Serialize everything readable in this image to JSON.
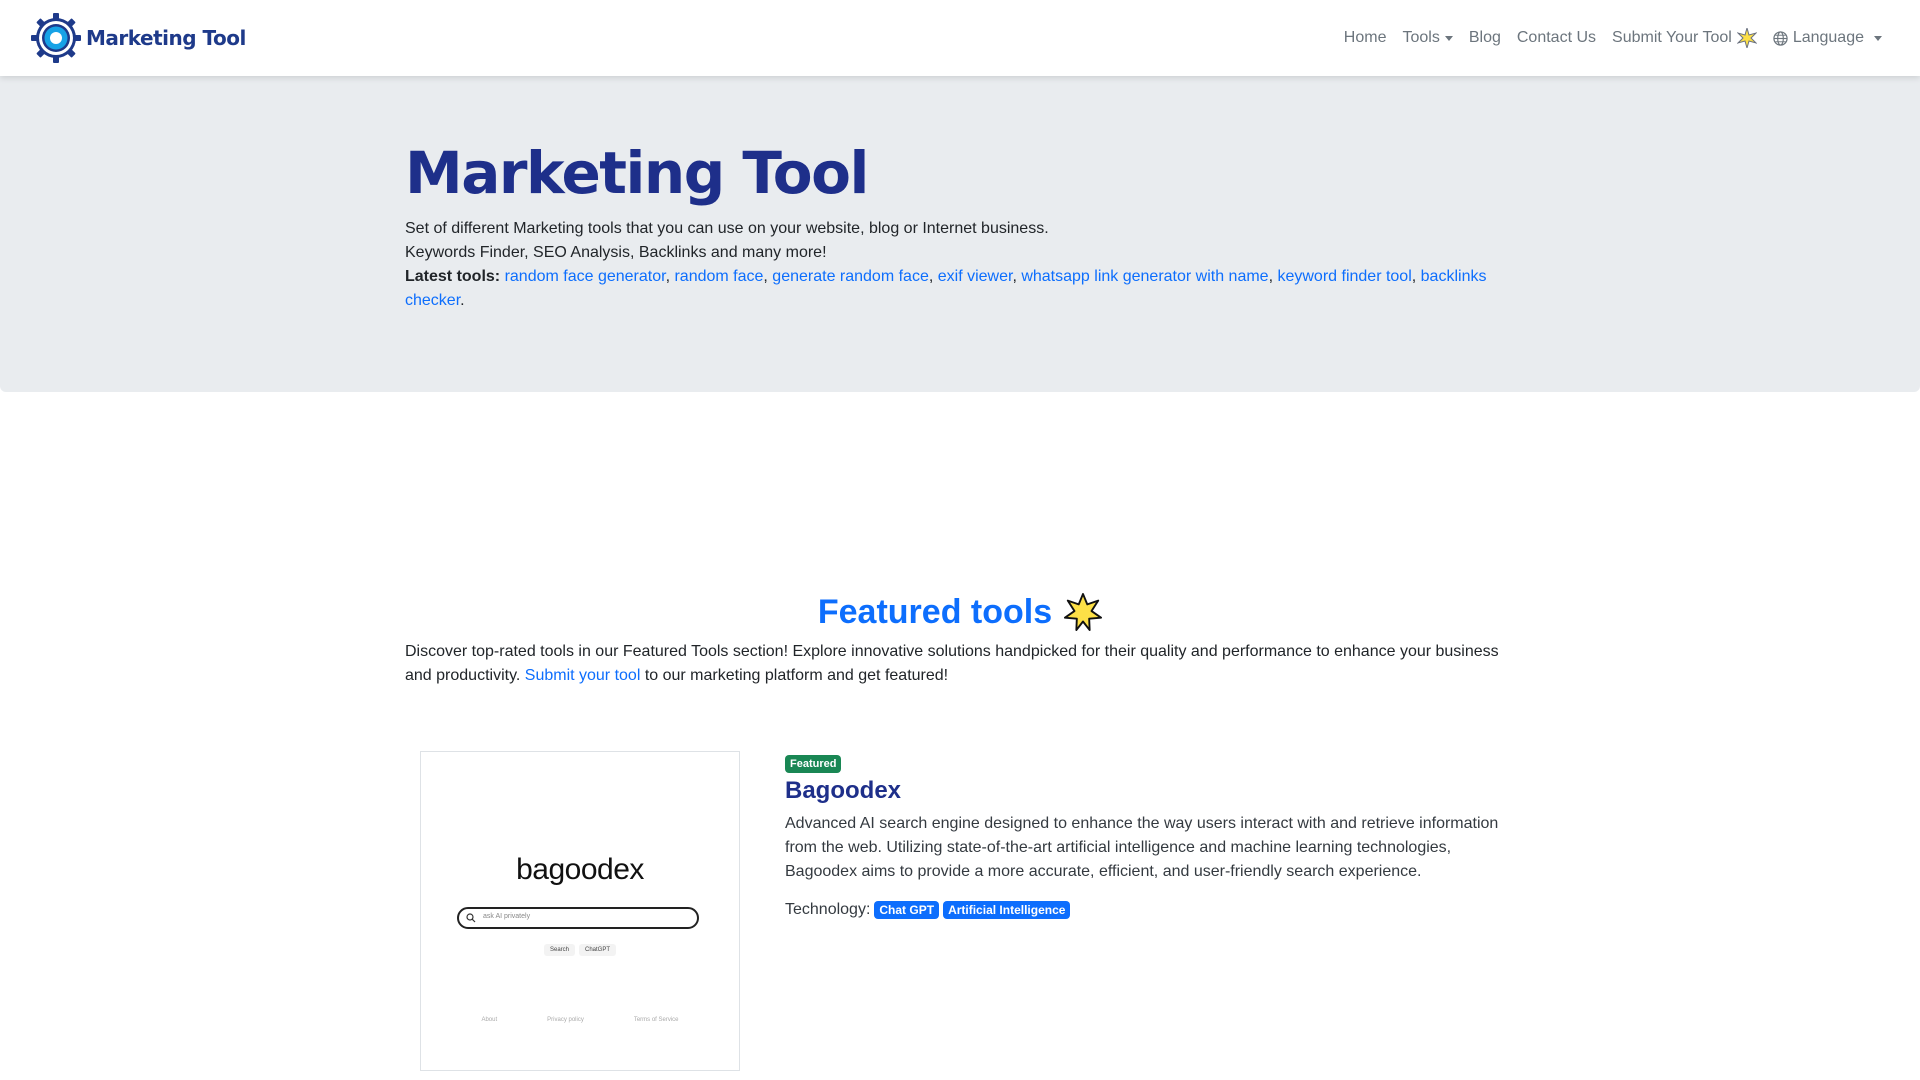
{
  "brand": {
    "name": "Marketing Tool"
  },
  "nav": {
    "home": "Home",
    "tools": "Tools",
    "blog": "Blog",
    "contact": "Contact Us",
    "submit": "Submit Your Tool",
    "language": "Language"
  },
  "hero": {
    "title": "Marketing Tool",
    "line1": "Set of different Marketing tools that you can use on your website, blog or Internet business.",
    "line2": "Keywords Finder, SEO Analysis, Backlinks and many more!",
    "latest_label": "Latest tools:",
    "latest_tools": [
      "random face generator",
      "random face",
      "generate random face",
      "exif viewer",
      "whatsapp link generator with name",
      "keyword finder tool",
      "backlinks checker"
    ]
  },
  "featured": {
    "title": "Featured tools",
    "desc_before": "Discover top-rated tools in our Featured Tools section! Explore innovative solutions handpicked for their quality and performance to enhance your business and productivity. ",
    "desc_link": "Submit your tool",
    "desc_after": " to our marketing platform and get featured!"
  },
  "tool": {
    "badge": "Featured",
    "name": "Bagoodex",
    "description": "Advanced AI search engine designed to enhance the way users interact with and retrieve information from the web. Utilizing state-of-the-art artificial intelligence and machine learning technologies, Bagoodex aims to provide a more accurate, efficient, and user-friendly search experience.",
    "technology_label": "Technology:",
    "technologies": [
      "Chat GPT",
      "Artificial Intelligence"
    ],
    "screenshot": {
      "logo": "bagoodex",
      "search_placeholder": "ask AI privately",
      "buttons": [
        "Search",
        "ChatGPT"
      ],
      "footer": [
        "About",
        "Privacy policy",
        "Terms of Service"
      ]
    }
  },
  "colors": {
    "brand_dark": "#1e2f8a",
    "link": "#0d6efd",
    "hero_bg": "#e9ecef",
    "featured_badge": "#198754",
    "star_fill": "#fde047"
  },
  "icons": [
    "gear-logo-icon",
    "sparkle-icon",
    "globe-icon",
    "star-burst-icon",
    "search-icon"
  ]
}
